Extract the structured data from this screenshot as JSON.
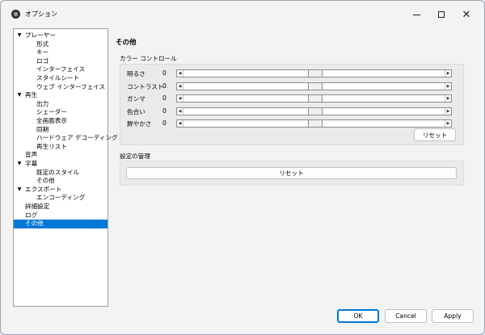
{
  "window": {
    "title": "オプション"
  },
  "tree": {
    "items": [
      {
        "label": "プレーヤー",
        "level": 0,
        "expanded": true
      },
      {
        "label": "形式",
        "level": 1
      },
      {
        "label": "キー",
        "level": 1
      },
      {
        "label": "ロゴ",
        "level": 1
      },
      {
        "label": "インターフェイス",
        "level": 1
      },
      {
        "label": "スタイルシート",
        "level": 1
      },
      {
        "label": "ウェブ インターフェイス",
        "level": 1
      },
      {
        "label": "再生",
        "level": 0,
        "expanded": true
      },
      {
        "label": "出力",
        "level": 1
      },
      {
        "label": "シェーダー",
        "level": 1
      },
      {
        "label": "全画面表示",
        "level": 1
      },
      {
        "label": "同期",
        "level": 1
      },
      {
        "label": "ハードウェア デコーディング",
        "level": 1
      },
      {
        "label": "再生リスト",
        "level": 1
      },
      {
        "label": "音声",
        "level": 0
      },
      {
        "label": "字幕",
        "level": 0,
        "expanded": true
      },
      {
        "label": "既定のスタイル",
        "level": 1
      },
      {
        "label": "その他",
        "level": 1
      },
      {
        "label": "エクスポート",
        "level": 0,
        "expanded": true
      },
      {
        "label": "エンコーディング",
        "level": 1
      },
      {
        "label": "詳細設定",
        "level": 0
      },
      {
        "label": "ログ",
        "level": 0
      },
      {
        "label": "その他",
        "level": 0,
        "selected": true
      }
    ]
  },
  "panel": {
    "title": "その他",
    "color_control": {
      "label": "カラー コントロール",
      "sliders": [
        {
          "label": "明るさ",
          "value": "0",
          "level": 0.5
        },
        {
          "label": "コントラスト",
          "value": "0",
          "level": 0.5
        },
        {
          "label": "ガンマ",
          "value": "0",
          "level": 0.5
        },
        {
          "label": "色合い",
          "value": "0",
          "level": 0.5
        },
        {
          "label": "鮮やかさ",
          "value": "0",
          "level": 0.5
        }
      ],
      "reset_label": "リセット"
    },
    "settings_management": {
      "label": "設定の管理",
      "reset_label": "リセット"
    }
  },
  "footer": {
    "ok_label": "OK",
    "cancel_label": "Cancel",
    "apply_label": "Apply"
  }
}
